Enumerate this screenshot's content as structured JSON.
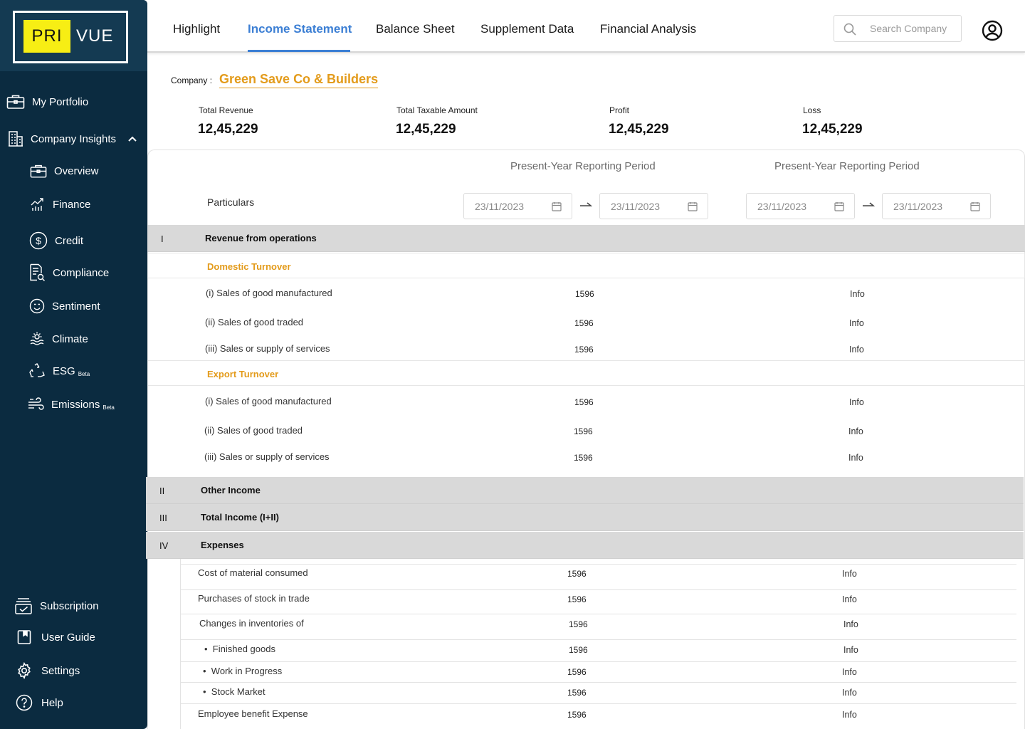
{
  "brand": {
    "pri": "PRI",
    "vue": "VUE"
  },
  "sidebar": {
    "items": [
      {
        "label": "My Portfolio"
      },
      {
        "label": "Company Insights"
      },
      {
        "label": "Overview"
      },
      {
        "label": "Finance"
      },
      {
        "label": "Credit"
      },
      {
        "label": "Compliance"
      },
      {
        "label": "Sentiment"
      },
      {
        "label": "Climate"
      },
      {
        "label": "ESG",
        "badge": "Beta"
      },
      {
        "label": "Emissions",
        "badge": "Beta"
      }
    ],
    "bottom": [
      {
        "label": "Subscription"
      },
      {
        "label": "User Guide"
      },
      {
        "label": "Settings"
      },
      {
        "label": "Help"
      }
    ]
  },
  "header": {
    "tabs": [
      {
        "label": "Highlight"
      },
      {
        "label": "Income Statement"
      },
      {
        "label": "Balance Sheet"
      },
      {
        "label": "Supplement Data"
      },
      {
        "label": "Financial Analysis"
      }
    ],
    "active_tab": "Income Statement",
    "search": {
      "placeholder": "Search Company",
      "value": ""
    }
  },
  "company": {
    "label": "Company :",
    "name": "Green Save Co & Builders"
  },
  "kpis": [
    {
      "label": "Total Revenue",
      "value": "12,45,229"
    },
    {
      "label": "Total Taxable Amount",
      "value": "12,45,229"
    },
    {
      "label": "Profit",
      "value": "12,45,229"
    },
    {
      "label": "Loss",
      "value": "12,45,229"
    }
  ],
  "table": {
    "particulars_label": "Particulars",
    "periods": [
      {
        "title": "Present-Year Reporting Period",
        "from": "23/11/2023",
        "to": "23/11/2023"
      },
      {
        "title": "Present-Year Reporting Period",
        "from": "23/11/2023",
        "to": "23/11/2023"
      }
    ],
    "sections": [
      {
        "num": "I",
        "title": "Revenue from operations"
      },
      {
        "num": "II",
        "title": "Other Income"
      },
      {
        "num": "III",
        "title": "Total Income (I+II)"
      },
      {
        "num": "IV",
        "title": "Expenses"
      }
    ],
    "subsections": [
      {
        "title": "Domestic Turnover"
      },
      {
        "title": "Export Turnover"
      }
    ],
    "domestic_rows": [
      {
        "label": "(i) Sales of good manufactured",
        "value": "1596",
        "info": "Info"
      },
      {
        "label": "(ii) Sales of good traded",
        "value": "1596",
        "info": "Info"
      },
      {
        "label": "(iii) Sales or supply of services",
        "value": "1596",
        "info": "Info"
      }
    ],
    "export_rows": [
      {
        "label": "(i) Sales of good manufactured",
        "value": "1596",
        "info": "Info"
      },
      {
        "label": "(ii) Sales of good traded",
        "value": "1596",
        "info": "Info"
      },
      {
        "label": "(iii) Sales or supply of services",
        "value": "1596",
        "info": "Info"
      }
    ],
    "expense_rows": [
      {
        "label": "Cost of material consumed",
        "value": "1596",
        "info": "Info"
      },
      {
        "label": "Purchases of stock in trade",
        "value": "1596",
        "info": "Info"
      },
      {
        "label": "Changes in inventories of",
        "value": "1596",
        "info": "Info"
      },
      {
        "label": "Finished goods",
        "value": "1596",
        "info": "Info"
      },
      {
        "label": "Work in Progress",
        "value": "1596",
        "info": "Info"
      },
      {
        "label": "Stock Market",
        "value": "1596",
        "info": "Info"
      },
      {
        "label": "Employee benefit Expense",
        "value": "1596",
        "info": "Info"
      }
    ]
  },
  "colors": {
    "sidebar_bg": "#0b2b40",
    "logo_yellow": "#f7ee14",
    "accent_blue": "#3c7fd4",
    "accent_orange": "#e39b1b",
    "section_gray": "#d9d9d9"
  },
  "icons": [
    "briefcase-icon",
    "building-icon",
    "chevron-up-icon",
    "briefcase-icon",
    "chart-hand-icon",
    "dollar-circle-icon",
    "document-search-icon",
    "smiley-icon",
    "climate-icon",
    "recycle-icon",
    "wind-icon",
    "subscription-icon",
    "book-icon",
    "gear-icon",
    "help-icon",
    "search-icon",
    "user-circle-icon",
    "calendar-icon",
    "arrow-right-icon"
  ]
}
